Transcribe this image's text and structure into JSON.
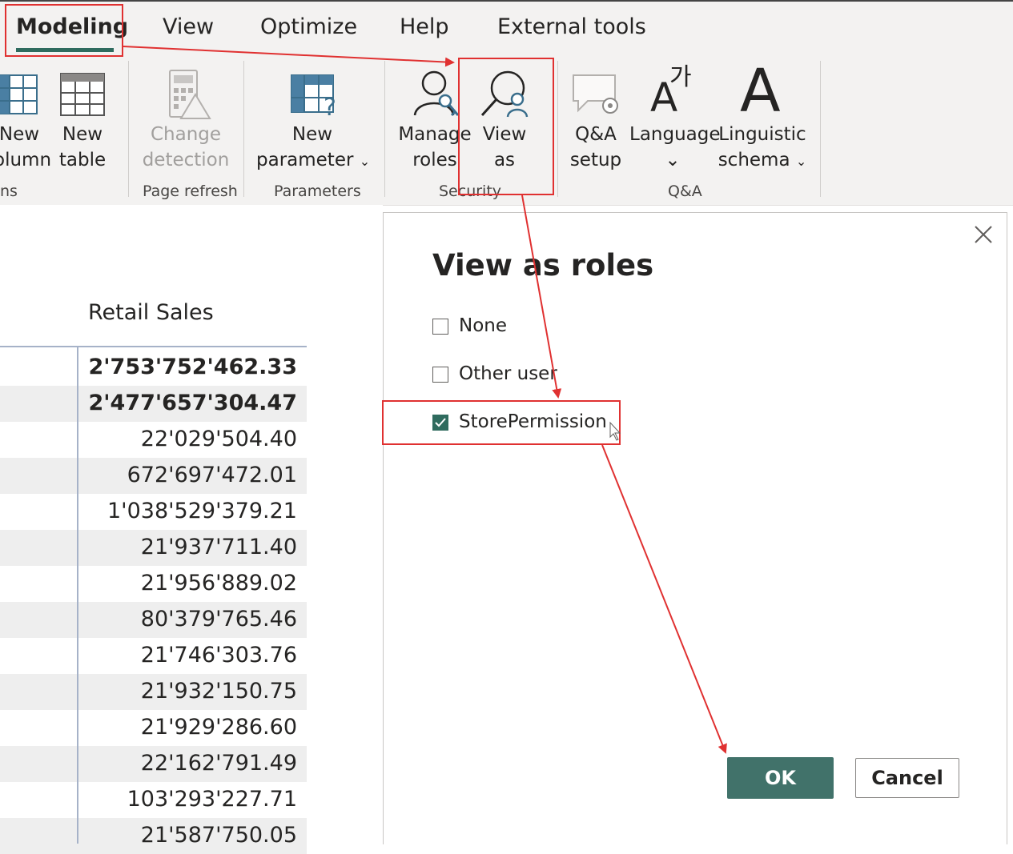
{
  "tabs": [
    {
      "label": "Modeling",
      "active": true
    },
    {
      "label": "View"
    },
    {
      "label": "Optimize"
    },
    {
      "label": "Help"
    },
    {
      "label": "External tools"
    }
  ],
  "ribbon": {
    "calculations": {
      "new_column_l1": "New",
      "new_column_l2": "olumn",
      "new_table_l1": "New",
      "new_table_l2": "table",
      "group_label": "ns"
    },
    "page_refresh": {
      "change_detection_l1": "Change",
      "change_detection_l2": "detection",
      "group_label": "Page refresh"
    },
    "parameters": {
      "new_parameter_l1": "New",
      "new_parameter_l2": "parameter",
      "group_label": "Parameters"
    },
    "security": {
      "manage_roles_l1": "Manage",
      "manage_roles_l2": "roles",
      "view_as_l1": "View",
      "view_as_l2": "as",
      "group_label": "Security"
    },
    "qa": {
      "qa_setup_l1": "Q&A",
      "qa_setup_l2": "setup",
      "language_l1": "Language",
      "linguistic_l1": "Linguistic",
      "linguistic_l2": "schema",
      "group_label": "Q&A"
    },
    "icons": {
      "chevron": "⌄",
      "big_a": "A",
      "hangul": "가"
    }
  },
  "table": {
    "column_header": "Retail Sales",
    "rows": [
      {
        "value": "2'753'752'462.33",
        "bold": true
      },
      {
        "value": "2'477'657'304.47",
        "bold": true
      },
      {
        "value": "22'029'504.40"
      },
      {
        "value": "672'697'472.01"
      },
      {
        "value": "1'038'529'379.21"
      },
      {
        "value": "21'937'711.40"
      },
      {
        "value": "21'956'889.02"
      },
      {
        "value": "80'379'765.46"
      },
      {
        "value": "21'746'303.76"
      },
      {
        "value": "21'932'150.75"
      },
      {
        "value": "21'929'286.60"
      },
      {
        "value": "22'162'791.49"
      },
      {
        "value": "103'293'227.71"
      },
      {
        "value": "21'587'750.05"
      }
    ]
  },
  "dialog": {
    "title": "View as roles",
    "options": [
      {
        "label": "None",
        "checked": false
      },
      {
        "label": "Other user",
        "checked": false
      },
      {
        "label": "StorePermission",
        "checked": true
      }
    ],
    "ok_label": "OK",
    "cancel_label": "Cancel"
  },
  "colors": {
    "accent": "#2f6b5e",
    "ok_button": "#41726a",
    "annotation": "#e03131"
  }
}
